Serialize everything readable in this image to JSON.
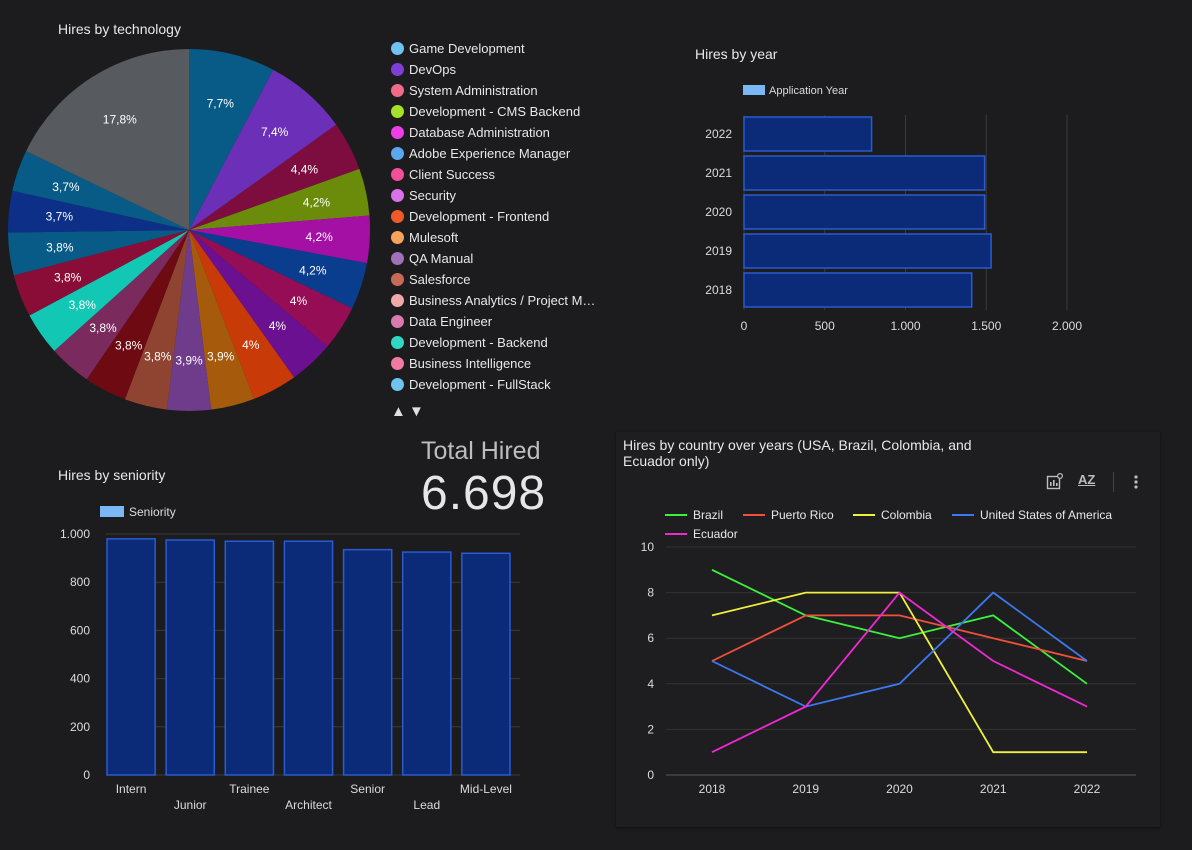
{
  "colors": {
    "background": "#1c1c1e",
    "bar_fill": "#0b2a78",
    "bar_stroke": "#2a5bd0",
    "grid": "#3a3a3a"
  },
  "pie": {
    "title": "Hires by technology",
    "legend_items": [
      {
        "label": "Game Development",
        "color": "#6fc3f0"
      },
      {
        "label": "DevOps",
        "color": "#7e3fd6"
      },
      {
        "label": "System Administration",
        "color": "#f06b8a"
      },
      {
        "label": "Development - CMS Backend",
        "color": "#a5e02a"
      },
      {
        "label": "Database Administration",
        "color": "#ee3ee8"
      },
      {
        "label": "Adobe Experience Manager",
        "color": "#5aa7ee"
      },
      {
        "label": "Client Success",
        "color": "#f0509a"
      },
      {
        "label": "Security",
        "color": "#d872e8"
      },
      {
        "label": "Development - Frontend",
        "color": "#f05a28"
      },
      {
        "label": "Mulesoft",
        "color": "#f5a25a"
      },
      {
        "label": "QA Manual",
        "color": "#a070b8"
      },
      {
        "label": "Salesforce",
        "color": "#c86a58"
      },
      {
        "label": "Business Analytics / Project M…",
        "color": "#f0a8a8"
      },
      {
        "label": "Data Engineer",
        "color": "#d67ab0"
      },
      {
        "label": "Development - Backend",
        "color": "#2ed8c2"
      },
      {
        "label": "Business Intelligence",
        "color": "#f07aa0"
      },
      {
        "label": "Development - FullStack",
        "color": "#6fc3f0"
      }
    ],
    "nav_up": "▲",
    "nav_down": "▼"
  },
  "kpi": {
    "label": "Total Hired",
    "value": "6.698"
  },
  "year_chart": {
    "title": "Hires by year",
    "legend": "Application Year"
  },
  "seniority_chart": {
    "title": "Hires by seniority",
    "legend": "Seniority"
  },
  "country_chart": {
    "title_line1": "Hires by country over years (USA, Brazil, Colombia, and",
    "title_line2": "Ecuador only)",
    "toolbar": {
      "insights_icon": "chart-insights-icon",
      "sort_label": "AZ",
      "more_icon": "more-vert-icon"
    }
  },
  "chart_data": [
    {
      "type": "pie",
      "title": "Hires by technology",
      "slices": [
        {
          "label": "7,7%",
          "value": 7.7,
          "color": "#075b86"
        },
        {
          "label": "7,4%",
          "value": 7.4,
          "color": "#6b2fb8"
        },
        {
          "label": "4,4%",
          "value": 4.4,
          "color": "#7d0d3e"
        },
        {
          "label": "4,2%",
          "value": 4.2,
          "color": "#6a8c0a"
        },
        {
          "label": "4,2%",
          "value": 4.2,
          "color": "#a40fa4"
        },
        {
          "label": "4,2%",
          "value": 4.2,
          "color": "#0b3d8e"
        },
        {
          "label": "4%",
          "value": 4.0,
          "color": "#950d55"
        },
        {
          "label": "4%",
          "value": 4.0,
          "color": "#6a1090"
        },
        {
          "label": "4%",
          "value": 4.0,
          "color": "#c83a08"
        },
        {
          "label": "3,9%",
          "value": 3.9,
          "color": "#a65a0b"
        },
        {
          "label": "3,9%",
          "value": 3.9,
          "color": "#6e3c8a"
        },
        {
          "label": "3,8%",
          "value": 3.8,
          "color": "#8e4430"
        },
        {
          "label": "3,8%",
          "value": 3.8,
          "color": "#6e0a12"
        },
        {
          "label": "3,8%",
          "value": 3.8,
          "color": "#7a2a5c"
        },
        {
          "label": "3,8%",
          "value": 3.8,
          "color": "#12c8b4"
        },
        {
          "label": "3,8%",
          "value": 3.8,
          "color": "#8a0d38"
        },
        {
          "label": "3,8%",
          "value": 3.8,
          "color": "#075b86"
        },
        {
          "label": "3,7%",
          "value": 3.7,
          "color": "#0d2f88"
        },
        {
          "label": "3,7%",
          "value": 3.7,
          "color": "#075b86"
        },
        {
          "label": "17,8%",
          "value": 17.8,
          "color": "#575a5e"
        }
      ]
    },
    {
      "type": "bar",
      "orientation": "horizontal",
      "title": "Hires by year",
      "categories": [
        "2022",
        "2021",
        "2020",
        "2019",
        "2018"
      ],
      "series": [
        {
          "name": "Application Year",
          "values": [
            790,
            1490,
            1490,
            1530,
            1410
          ]
        }
      ],
      "xlim": [
        0,
        2000
      ],
      "xticks": [
        0,
        500,
        1000,
        1500,
        2000
      ],
      "xtick_labels": [
        "0",
        "500",
        "1.000",
        "1.500",
        "2.000"
      ]
    },
    {
      "type": "bar",
      "title": "Hires by seniority",
      "categories": [
        "Intern",
        "Junior",
        "Trainee",
        "Architect",
        "Senior",
        "Lead",
        "Mid-Level"
      ],
      "series": [
        {
          "name": "Seniority",
          "values": [
            980,
            975,
            970,
            970,
            935,
            925,
            920
          ]
        }
      ],
      "ylim": [
        0,
        1000
      ],
      "yticks": [
        0,
        200,
        400,
        600,
        800,
        1000
      ],
      "ytick_labels": [
        "0",
        "200",
        "400",
        "600",
        "800",
        "1.000"
      ]
    },
    {
      "type": "line",
      "title": "Hires by country over years (USA, Brazil, Colombia, and Ecuador only)",
      "x": [
        "2018",
        "2019",
        "2020",
        "2021",
        "2022"
      ],
      "ylim": [
        0,
        10
      ],
      "yticks": [
        0,
        2,
        4,
        6,
        8,
        10
      ],
      "series": [
        {
          "name": "Brazil",
          "color": "#3cf03c",
          "values": [
            9,
            7,
            6,
            7,
            4
          ]
        },
        {
          "name": "Puerto Rico",
          "color": "#f0503c",
          "values": [
            5,
            7,
            7,
            6,
            5
          ]
        },
        {
          "name": "Colombia",
          "color": "#f0f03c",
          "values": [
            7,
            8,
            8,
            1,
            1
          ]
        },
        {
          "name": "United States of America",
          "color": "#3c78f0",
          "values": [
            5,
            3,
            4,
            8,
            5
          ]
        },
        {
          "name": "Ecuador",
          "color": "#f028d2",
          "values": [
            1,
            3,
            8,
            5,
            3
          ]
        }
      ]
    }
  ]
}
